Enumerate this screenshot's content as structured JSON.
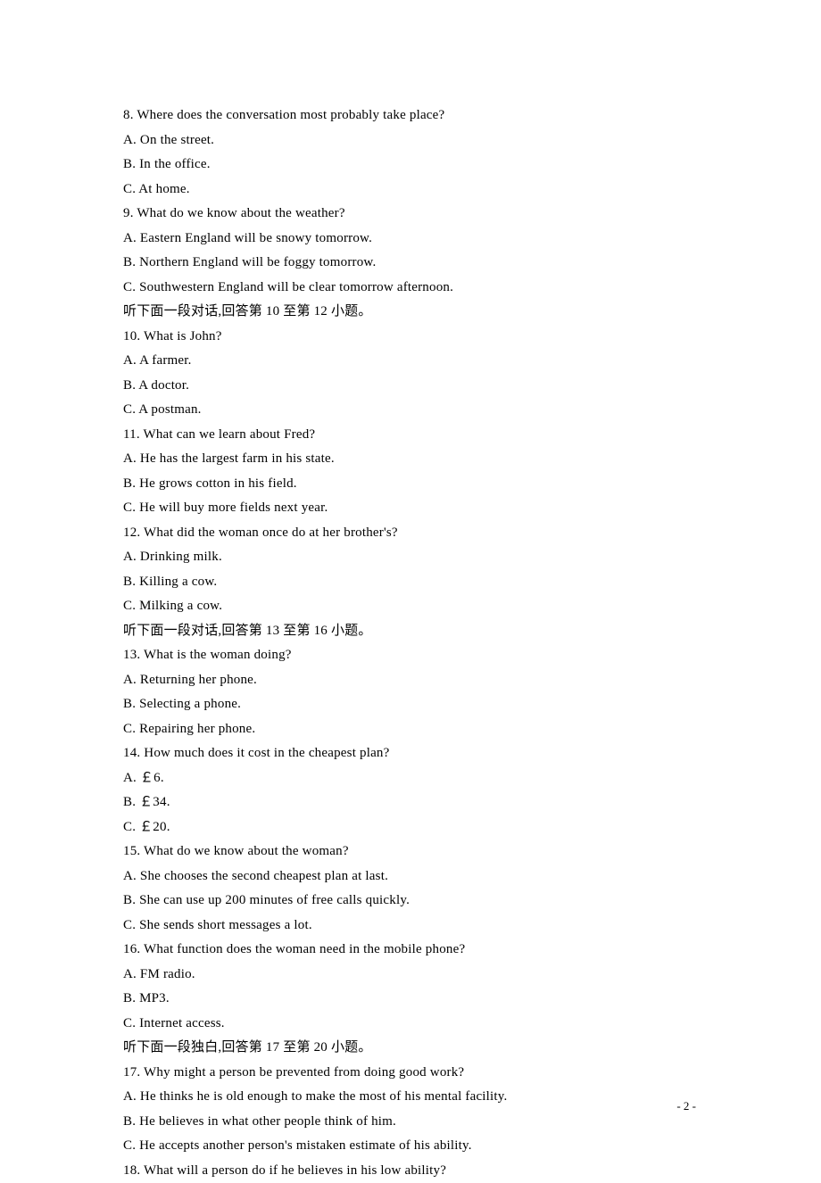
{
  "q8": {
    "stem": "8. Where does the conversation most probably take place?",
    "a": "A. On the street.",
    "b": "B. In the office.",
    "c": "C. At home."
  },
  "q9": {
    "stem": "9. What do we know about the weather?",
    "a": "A. Eastern England will be snowy tomorrow.",
    "b": "B. Northern England will be foggy tomorrow.",
    "c": "C. Southwestern England will be clear tomorrow afternoon."
  },
  "instr1": "听下面一段对话,回答第 10 至第 12 小题。",
  "q10": {
    "stem": "10. What is John?",
    "a": "A. A farmer.",
    "b": "B. A doctor.",
    "c": "C. A postman."
  },
  "q11": {
    "stem": "11. What can we learn about Fred?",
    "a": "A. He has the largest farm in his state.",
    "b": "B. He grows cotton in his field.",
    "c": "C. He will buy more fields next year."
  },
  "q12": {
    "stem": "12. What did the woman once do at her brother's?",
    "a": "A. Drinking milk.",
    "b": "B. Killing a cow.",
    "c": "C. Milking a cow."
  },
  "instr2": "听下面一段对话,回答第 13 至第 16 小题。",
  "q13": {
    "stem": "13. What is the woman doing?",
    "a": "A. Returning her phone.",
    "b": "B. Selecting a phone.",
    "c": "C. Repairing her phone."
  },
  "q14": {
    "stem": "14. How much does it cost in the cheapest plan?",
    "a": "A. ￡6.",
    "b": "B. ￡34.",
    "c": "C. ￡20."
  },
  "q15": {
    "stem": "15. What do we know about the woman?",
    "a": "A. She chooses the second cheapest plan at last.",
    "b": "B. She can use up 200 minutes of free calls quickly.",
    "c": "C. She sends short messages a lot."
  },
  "q16": {
    "stem": "16. What function does the woman need in the mobile phone?",
    "a": "A. FM radio.",
    "b": "B. MP3.",
    "c": "C. Internet access."
  },
  "instr3": "听下面一段独白,回答第 17 至第 20 小题。",
  "q17": {
    "stem": "17. Why might a person be prevented from doing good work?",
    "a": "A. He thinks he is old enough to make the most of his mental facility.",
    "b": "B. He believes in what other people think of him.",
    "c": "C. He accepts another person's mistaken estimate of his ability."
  },
  "q18": {
    "stem": "18. What will a person do if he believes in his low ability?"
  },
  "page_number": "- 2 -"
}
